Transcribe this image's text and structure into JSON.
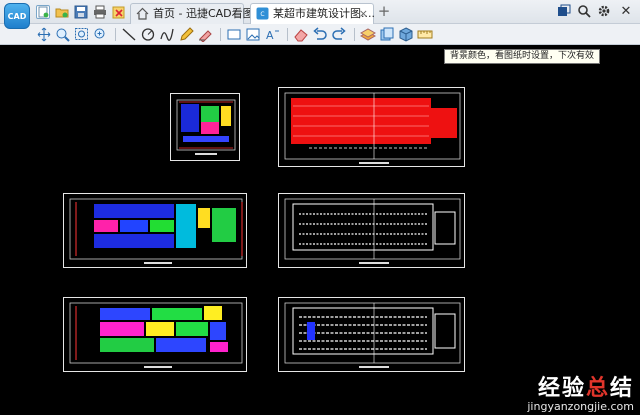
{
  "app": {
    "logo_text": "CAD"
  },
  "tabs": [
    {
      "label": "首页 - 迅捷CAD看图",
      "icon": "home-icon",
      "active": false
    },
    {
      "label": "某超市建筑设计图....",
      "icon": "cad-file-icon",
      "active": true
    }
  ],
  "tab_close_glyph": "×",
  "tab_add_glyph": "+",
  "quick_access": [
    "new-file-icon",
    "open-folder-icon",
    "save-icon",
    "print-icon",
    "undo-history-icon"
  ],
  "toolbar_groups": [
    [
      "pan-icon",
      "zoom-window-icon",
      "zoom-extents-icon",
      "zoom-realtime-icon"
    ],
    [
      "line-icon",
      "circle-icon",
      "polyline-icon",
      "pencil-icon",
      "eraser-pen-icon"
    ],
    [
      "rectangle-icon",
      "image-insert-icon",
      "text-icon"
    ],
    [
      "erase-icon",
      "undo-icon",
      "redo-icon"
    ],
    [
      "layer-icon",
      "layout-icon",
      "3d-view-icon",
      "measure-icon"
    ]
  ],
  "background_color_button": {
    "icon": "background-color-icon",
    "highlight": "#e2231a"
  },
  "tooltip": "背景颜色，看图纸时设置，下次有效",
  "window_controls": [
    "restore-window-icon",
    "zoom-search-icon",
    "settings-gear-icon",
    "close-window-icon"
  ],
  "window_close_glyph": "✕",
  "canvas": {
    "background": "#000000"
  },
  "drawings": [
    {
      "id": "plan-small"
    },
    {
      "id": "plan-red"
    },
    {
      "id": "plan-mixed"
    },
    {
      "id": "plan-white"
    },
    {
      "id": "plan-color-blocks"
    },
    {
      "id": "plan-white-2"
    }
  ],
  "watermark": {
    "chars_white_1": "经验",
    "chars_red": "总",
    "chars_white_2": "结",
    "domain": "jingyanzongjie.com"
  }
}
